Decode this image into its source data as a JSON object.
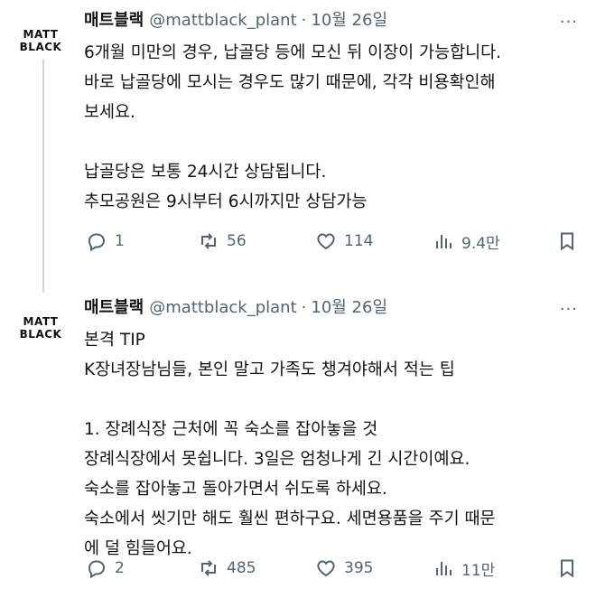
{
  "tweets": [
    {
      "avatar": {
        "line1": "MATT",
        "line2": "BLACK"
      },
      "name": "매트블랙",
      "handle": "@mattblack_plant",
      "separator": "·",
      "date": "10월 26일",
      "more": "···",
      "lines": [
        "6개월 미만의 경우, 납골당 등에 모신 뒤 이장이 가능합니다.",
        "바로 납골당에 모시는 경우도 많기 때문에, 각각 비용확인해",
        "보세요.",
        "",
        "납골당은 보통 24시간 상담됩니다.",
        "추모공원은 9시부터 6시까지만 상담가능"
      ],
      "replies": "1",
      "retweets": "56",
      "likes": "114",
      "views": "9.4만"
    },
    {
      "avatar": {
        "line1": "MATT",
        "line2": "BLACK"
      },
      "name": "매트블랙",
      "handle": "@mattblack_plant",
      "separator": "·",
      "date": "10월 26일",
      "more": "···",
      "lines": [
        "본격 TIP",
        "K장녀장남님들, 본인 말고 가족도 챙겨야해서 적는 팁",
        "",
        "1. 장례식장 근처에 꼭 숙소를 잡아놓을 것",
        "장례식장에서 못쉽니다. 3일은 엄청나게 긴 시간이예요.",
        "숙소를 잡아놓고 돌아가면서 쉬도록 하세요.",
        "숙소에서 씻기만 해도 훨씬 편하구요. 세면용품을 주기 때문",
        "에 덜 힘들어요."
      ],
      "replies": "2",
      "retweets": "485",
      "likes": "395",
      "views": "11만"
    }
  ]
}
